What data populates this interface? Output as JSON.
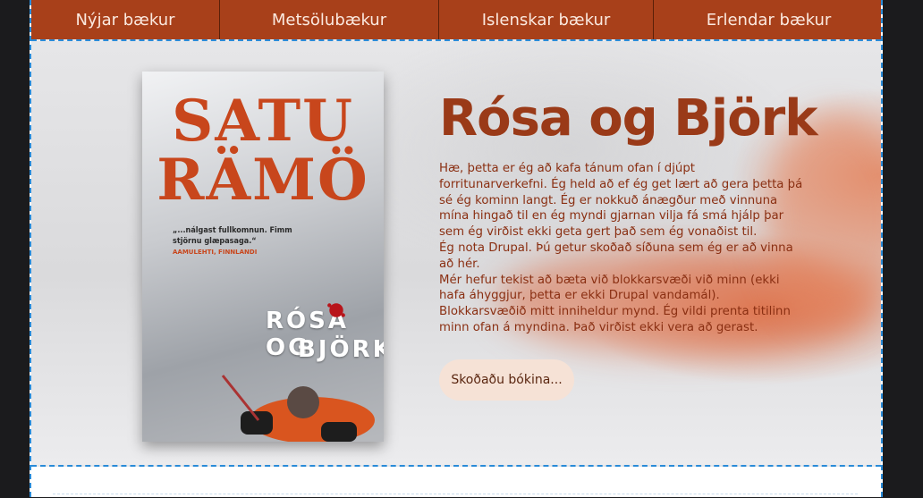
{
  "nav": {
    "items": [
      {
        "label": "Nýjar bækur"
      },
      {
        "label": "Metsölubækur"
      },
      {
        "label": "Islenskar bækur"
      },
      {
        "label": "Erlendar bækur"
      }
    ]
  },
  "hero": {
    "title": "Rósa og Björk",
    "paragraphs": [
      "Hæ, þetta er ég að kafa tánum ofan í djúpt forritunarverkefni. Ég held að ef ég get lært að gera þetta þá sé ég kominn langt. Ég er nokkuð ánægður með vinnuna mína hingað til en ég myndi gjarnan vilja fá smá hjálp þar sem ég virðist ekki geta gert það sem ég vonaðist til.",
      "Ég nota Drupal. Þú getur skoðað síðuna sem ég er að vinna að hér.",
      "Mér hefur tekist að bæta við blokkarsvæði við minn (ekki hafa áhyggjur, þetta er ekki Drupal vandamál). Blokkarsvæðið mitt inniheldur mynd. Ég vildi prenta titilinn minn ofan á myndina. Það virðist ekki vera að gerast."
    ],
    "cta_label": "Skoðaðu bókina..."
  },
  "cover": {
    "author_line1": "SATU",
    "author_line2": "RÄMÖ",
    "quote": "„...nálgast fullkomnun. Fimm stjörnu glæpasaga.“",
    "quote_source": "AAMULEHTI, FINNLANDI",
    "title_line1": "RÓSA OG",
    "title_line2": "BJÖRK"
  },
  "colors": {
    "nav_bg": "#a8401a",
    "title": "#9a3a18",
    "body_text": "#8a2f12",
    "cta_bg": "#f6e2d6"
  }
}
